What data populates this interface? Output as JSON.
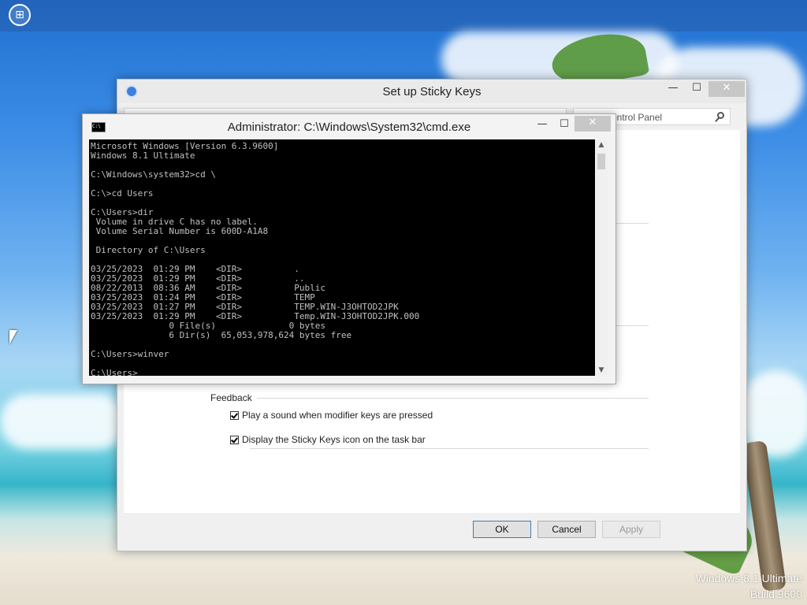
{
  "desktop": {
    "start_icon": "windows-logo-icon",
    "watermark": [
      "Windows 8.1 Ultimate",
      "Build 9600"
    ]
  },
  "sticky_keys": {
    "title": "Set up Sticky Keys",
    "search_text": "ontrol Panel",
    "feedback_label": "Feedback",
    "options": [
      {
        "label": "Play a sound when modifier keys are pressed",
        "checked": true
      },
      {
        "label": "Display the Sticky Keys icon on the task bar",
        "checked": true
      }
    ],
    "buttons": {
      "ok": "OK",
      "cancel": "Cancel",
      "apply": "Apply"
    }
  },
  "cmd": {
    "title": "Administrator: C:\\Windows\\System32\\cmd.exe",
    "icon_text": "C:\\",
    "output": "Microsoft Windows [Version 6.3.9600]\nWindows 8.1 Ultimate\n\nC:\\Windows\\system32>cd \\\n\nC:\\>cd Users\n\nC:\\Users>dir\n Volume in drive C has no label.\n Volume Serial Number is 600D-A1A8\n\n Directory of C:\\Users\n\n03/25/2023  01:29 PM    <DIR>          .\n03/25/2023  01:29 PM    <DIR>          ..\n08/22/2013  08:36 AM    <DIR>          Public\n03/25/2023  01:24 PM    <DIR>          TEMP\n03/25/2023  01:27 PM    <DIR>          TEMP.WIN-J3OHTOD2JPK\n03/25/2023  01:29 PM    <DIR>          Temp.WIN-J3OHTOD2JPK.000\n               0 File(s)              0 bytes\n               6 Dir(s)  65,053,978,624 bytes free\n\nC:\\Users>winver\n\nC:\\Users>"
  }
}
